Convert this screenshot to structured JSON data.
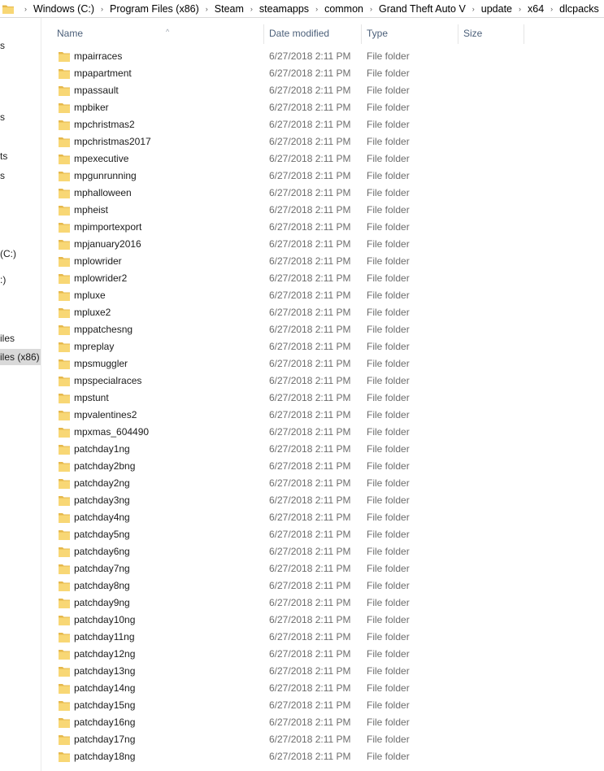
{
  "breadcrumb": [
    "Windows (C:)",
    "Program Files (x86)",
    "Steam",
    "steamapps",
    "common",
    "Grand Theft Auto V",
    "update",
    "x64",
    "dlcpacks"
  ],
  "nav_items": [
    {
      "label": "s",
      "selected": false
    },
    {
      "label": "s",
      "selected": false
    },
    {
      "label": "ts",
      "selected": false
    },
    {
      "label": "s",
      "selected": false
    },
    {
      "label": "(C:)",
      "selected": false
    },
    {
      "label": ":)",
      "selected": false
    },
    {
      "label": "iles",
      "selected": false
    },
    {
      "label": "iles (x86)",
      "selected": true
    }
  ],
  "columns": {
    "name": "Name",
    "date": "Date modified",
    "type": "Type",
    "size": "Size"
  },
  "sort_indicator": "^",
  "files": [
    {
      "name": "mpairraces",
      "date": "6/27/2018 2:11 PM",
      "type": "File folder"
    },
    {
      "name": "mpapartment",
      "date": "6/27/2018 2:11 PM",
      "type": "File folder"
    },
    {
      "name": "mpassault",
      "date": "6/27/2018 2:11 PM",
      "type": "File folder"
    },
    {
      "name": "mpbiker",
      "date": "6/27/2018 2:11 PM",
      "type": "File folder"
    },
    {
      "name": "mpchristmas2",
      "date": "6/27/2018 2:11 PM",
      "type": "File folder"
    },
    {
      "name": "mpchristmas2017",
      "date": "6/27/2018 2:11 PM",
      "type": "File folder"
    },
    {
      "name": "mpexecutive",
      "date": "6/27/2018 2:11 PM",
      "type": "File folder"
    },
    {
      "name": "mpgunrunning",
      "date": "6/27/2018 2:11 PM",
      "type": "File folder"
    },
    {
      "name": "mphalloween",
      "date": "6/27/2018 2:11 PM",
      "type": "File folder"
    },
    {
      "name": "mpheist",
      "date": "6/27/2018 2:11 PM",
      "type": "File folder"
    },
    {
      "name": "mpimportexport",
      "date": "6/27/2018 2:11 PM",
      "type": "File folder"
    },
    {
      "name": "mpjanuary2016",
      "date": "6/27/2018 2:11 PM",
      "type": "File folder"
    },
    {
      "name": "mplowrider",
      "date": "6/27/2018 2:11 PM",
      "type": "File folder"
    },
    {
      "name": "mplowrider2",
      "date": "6/27/2018 2:11 PM",
      "type": "File folder"
    },
    {
      "name": "mpluxe",
      "date": "6/27/2018 2:11 PM",
      "type": "File folder"
    },
    {
      "name": "mpluxe2",
      "date": "6/27/2018 2:11 PM",
      "type": "File folder"
    },
    {
      "name": "mppatchesng",
      "date": "6/27/2018 2:11 PM",
      "type": "File folder"
    },
    {
      "name": "mpreplay",
      "date": "6/27/2018 2:11 PM",
      "type": "File folder"
    },
    {
      "name": "mpsmuggler",
      "date": "6/27/2018 2:11 PM",
      "type": "File folder"
    },
    {
      "name": "mpspecialraces",
      "date": "6/27/2018 2:11 PM",
      "type": "File folder"
    },
    {
      "name": "mpstunt",
      "date": "6/27/2018 2:11 PM",
      "type": "File folder"
    },
    {
      "name": "mpvalentines2",
      "date": "6/27/2018 2:11 PM",
      "type": "File folder"
    },
    {
      "name": "mpxmas_604490",
      "date": "6/27/2018 2:11 PM",
      "type": "File folder"
    },
    {
      "name": "patchday1ng",
      "date": "6/27/2018 2:11 PM",
      "type": "File folder"
    },
    {
      "name": "patchday2bng",
      "date": "6/27/2018 2:11 PM",
      "type": "File folder"
    },
    {
      "name": "patchday2ng",
      "date": "6/27/2018 2:11 PM",
      "type": "File folder"
    },
    {
      "name": "patchday3ng",
      "date": "6/27/2018 2:11 PM",
      "type": "File folder"
    },
    {
      "name": "patchday4ng",
      "date": "6/27/2018 2:11 PM",
      "type": "File folder"
    },
    {
      "name": "patchday5ng",
      "date": "6/27/2018 2:11 PM",
      "type": "File folder"
    },
    {
      "name": "patchday6ng",
      "date": "6/27/2018 2:11 PM",
      "type": "File folder"
    },
    {
      "name": "patchday7ng",
      "date": "6/27/2018 2:11 PM",
      "type": "File folder"
    },
    {
      "name": "patchday8ng",
      "date": "6/27/2018 2:11 PM",
      "type": "File folder"
    },
    {
      "name": "patchday9ng",
      "date": "6/27/2018 2:11 PM",
      "type": "File folder"
    },
    {
      "name": "patchday10ng",
      "date": "6/27/2018 2:11 PM",
      "type": "File folder"
    },
    {
      "name": "patchday11ng",
      "date": "6/27/2018 2:11 PM",
      "type": "File folder"
    },
    {
      "name": "patchday12ng",
      "date": "6/27/2018 2:11 PM",
      "type": "File folder"
    },
    {
      "name": "patchday13ng",
      "date": "6/27/2018 2:11 PM",
      "type": "File folder"
    },
    {
      "name": "patchday14ng",
      "date": "6/27/2018 2:11 PM",
      "type": "File folder"
    },
    {
      "name": "patchday15ng",
      "date": "6/27/2018 2:11 PM",
      "type": "File folder"
    },
    {
      "name": "patchday16ng",
      "date": "6/27/2018 2:11 PM",
      "type": "File folder"
    },
    {
      "name": "patchday17ng",
      "date": "6/27/2018 2:11 PM",
      "type": "File folder"
    },
    {
      "name": "patchday18ng",
      "date": "6/27/2018 2:11 PM",
      "type": "File folder"
    }
  ],
  "colors": {
    "folder": "#f8d775",
    "folder_dark": "#e6b84c",
    "header_text": "#4c607a",
    "muted_text": "#6d6d6d",
    "selected_nav": "#d9d9d9"
  },
  "icons": {
    "folder": "folder-icon",
    "separator": "chevron-right-icon"
  }
}
